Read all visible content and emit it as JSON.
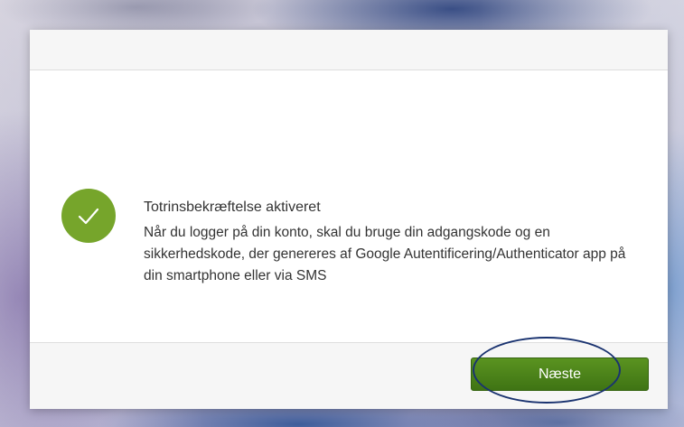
{
  "dialog": {
    "title": "Totrinsbekræftelse aktiveret",
    "message": "Når du logger på din konto, skal du bruge din adgangskode og en sikkerhedskode, der genereres af Google Autentificering/Authenticator app på din smartphone eller via SMS",
    "status_icon": "checkmark-icon",
    "next_label": "Næste"
  },
  "colors": {
    "success": "#76a52b",
    "button": "#4a8019",
    "annotation": "#1a3370"
  }
}
